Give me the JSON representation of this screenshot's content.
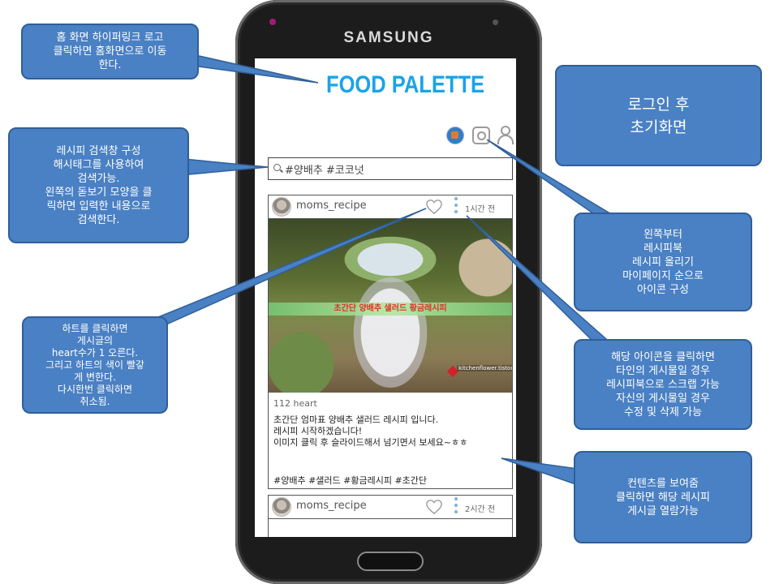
{
  "phone": {
    "brand": "SAMSUNG"
  },
  "app": {
    "logo": "FOOD PALETTE",
    "icons": {
      "recipe_book": "recipe-book-icon",
      "upload": "camera-icon",
      "mypage": "person-icon"
    },
    "search": {
      "value": "#양배추 #코코넛",
      "icon": "search-icon"
    }
  },
  "posts": [
    {
      "username": "moms_recipe",
      "time": "1시간 전",
      "image_banner": "초간단 양배추 샐러드 황금레시피",
      "image_watermark": "kitchenflower.tistory.com",
      "likes": "112  heart",
      "caption_lines": [
        "초간단 엄마표 양배추 샐러드 레시피 입니다.",
        "레시피 시작하겠습니다!",
        "이미지 클릭 후 슬라이드해서 넘기면서 보세요~ㅎㅎ"
      ],
      "tags": "#양배추 #샐러드 #황금레시피 #초간단"
    },
    {
      "username": "moms_recipe",
      "time": "2시간 전"
    }
  ],
  "callouts": {
    "logo": [
      "홈 화면 하이퍼링크 로고",
      "클릭하면 홈화면으로 이동",
      "한다."
    ],
    "initial": [
      "로그인 후",
      "초기화면"
    ],
    "search": [
      "레시피 검색창 구성",
      "해시태그를 사용하여",
      "검색가능.",
      "왼쪽의 돋보기 모양을 클",
      "릭하면 입력한 내용으로",
      "검색한다."
    ],
    "icons": [
      "왼쪽부터",
      "레시피북",
      "레시피 올리기",
      "마이페이지 순으로",
      "아이콘 구성"
    ],
    "heart": [
      "하트를 클릭하면",
      "게시글의",
      "heart수가 1 오른다.",
      "그리고 하트의 색이 빨갛",
      "게 변한다.",
      "다시한번 클릭하면",
      "취소됨."
    ],
    "menu": [
      "해당 아이콘을 클릭하면",
      "타인의 게시물일 경우",
      "레시피북으로 스크랩 가능",
      "자신의 게시물일 경우",
      "수정 및 삭제 가능"
    ],
    "content": [
      "컨텐츠를 보여줌",
      "클릭하면 해당 레시피",
      "게시글 열람가능"
    ]
  },
  "colors": {
    "logo": "#1aa3e8",
    "callout": "#4a80c4",
    "heart_outline": "#999999"
  }
}
